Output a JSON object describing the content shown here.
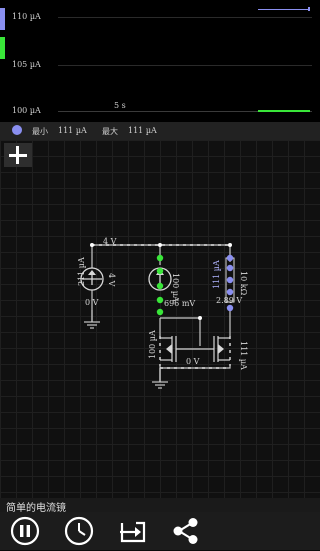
{
  "scope": {
    "y_labels": [
      "110 µA",
      "105 µA",
      "100 µA"
    ],
    "time_label": "5 s",
    "legend_min_label": "最小",
    "legend_min_value": "111 µA",
    "legend_max_label": "最大",
    "legend_max_value": "111 µA",
    "trace_color": "#8a8ff0",
    "marker_colors": [
      "#8a8ff0",
      "#39e639"
    ]
  },
  "circuit": {
    "top_voltage": "4 V",
    "src1_current": "211 µA",
    "src1_voltage": "4 V",
    "src1_bottom_voltage": "0 V",
    "src2_current": "100 µA",
    "mid_voltage": "696 mV",
    "right_current": "111 µA",
    "resistor_value": "10 kΩ",
    "right_voltage": "2.89 V",
    "fet_left_current": "100 µA",
    "fet_right_current": "111 µA",
    "bottom_voltage": "0 V"
  },
  "title": "简单的电流镜",
  "toolbar": {
    "pause": "pause-icon",
    "clock": "clock-icon",
    "export": "export-icon",
    "share": "share-icon"
  }
}
